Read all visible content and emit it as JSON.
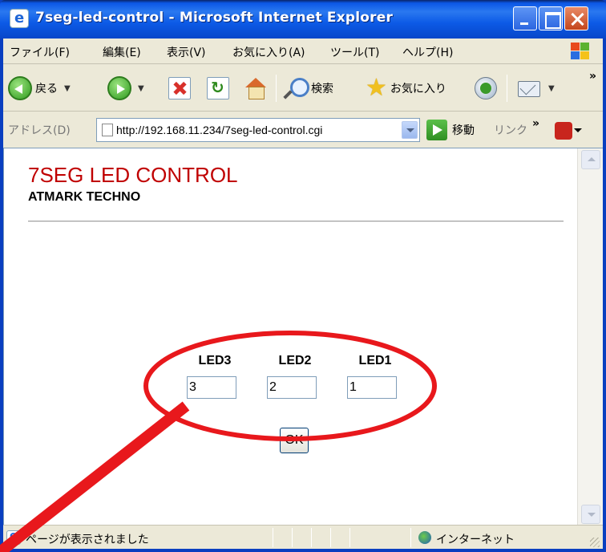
{
  "window": {
    "title": "7seg-led-control - Microsoft Internet Explorer"
  },
  "menu": {
    "items": [
      "ファイル(F)",
      "編集(E)",
      "表示(V)",
      "お気に入り(A)",
      "ツール(T)",
      "ヘルプ(H)"
    ]
  },
  "toolbar": {
    "back_label": "戻る",
    "search_label": "検索",
    "favorites_label": "お気に入り"
  },
  "address": {
    "label": "アドレス(D)",
    "url": "http://192.168.11.234/7seg-led-control.cgi",
    "go_label": "移動",
    "links_label": "リンク"
  },
  "page": {
    "heading": "7SEG LED CONTROL",
    "subheading": "ATMARK TECHNO",
    "heading_color": "#c00000",
    "leds": [
      {
        "label": "LED3",
        "value": "3"
      },
      {
        "label": "LED2",
        "value": "2"
      },
      {
        "label": "LED1",
        "value": "1"
      }
    ],
    "ok_label": "OK"
  },
  "status": {
    "text": "ページが表示されました",
    "zone": "インターネット"
  },
  "annotation": {
    "color": "#e8181c"
  }
}
